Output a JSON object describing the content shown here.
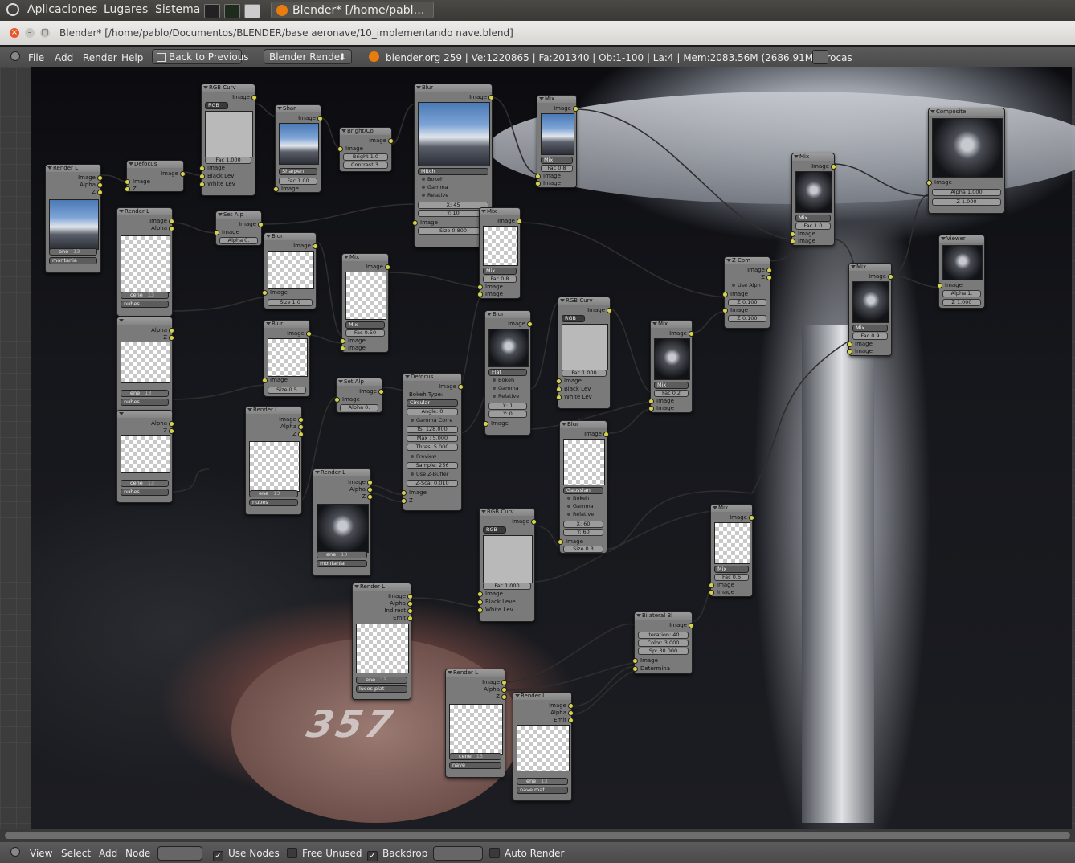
{
  "os_bar": {
    "menus": [
      "Aplicaciones",
      "Lugares",
      "Sistema"
    ],
    "task": "Blender* [/home/pabl…"
  },
  "window": {
    "title": "Blender* [/home/pablo/Documentos/BLENDER/base  aeronave/10_implementando  nave.blend]"
  },
  "header": {
    "menus": [
      "File",
      "Add",
      "Render",
      "Help"
    ],
    "back_button": "Back to Previous",
    "engine": "Blender Render",
    "stats": "blender.org 259 | Ve:1220865 | Fa:201340 | Ob:1-100 | La:4 | Mem:2083.56M (2686.91M) | rocas"
  },
  "nodes": {
    "render1": {
      "title": "Render L",
      "out": [
        "Image",
        "Alpha",
        "Z"
      ],
      "layer": "ene",
      "num": "13",
      "scene": "montania"
    },
    "defocus1": {
      "title": "Defocus",
      "out": "Image",
      "in": [
        "Image",
        "Z"
      ]
    },
    "rgbcurv1": {
      "title": "RGB Curv",
      "out": "Image",
      "tabs": "RGB",
      "fac": "Fac 1.000",
      "in": [
        "Image",
        "Black Lev",
        "White Lev"
      ]
    },
    "sharpen": {
      "title": "Shar",
      "out": "Image",
      "mode": "Sharpen",
      "fac": "Fac 1.00",
      "in": "Image"
    },
    "brightco": {
      "title": "Bright/Co",
      "out": "Image",
      "in": "Image",
      "bright": "Bright 1.0",
      "contrast": "Contrast 3."
    },
    "blur1": {
      "title": "Blur",
      "out": "Image",
      "filter": "Mitch",
      "opts": [
        "Bokeh",
        "Gamma",
        "Relative"
      ],
      "x": "X: 45",
      "y": "Y: 10",
      "in": "Image",
      "size": "Size 0.800"
    },
    "mix1": {
      "title": "Mix",
      "out": "Image",
      "mode": "Mix",
      "fac": "Fac 0.8",
      "in": [
        "Image",
        "Image"
      ]
    },
    "composite": {
      "title": "Composite",
      "in": "Image",
      "alpha": "Alpha 1.000",
      "z": "Z 1.000"
    },
    "render2": {
      "title": "Render L",
      "out": [
        "Image",
        "Alpha"
      ],
      "layer": "cene",
      "num": "13",
      "scene": "nubes"
    },
    "setalpha1": {
      "title": "Set Alp",
      "out": "Image",
      "in": "Image",
      "alpha": "Alpha 0."
    },
    "blur2": {
      "title": "Blur",
      "out": "Image",
      "in": "Image",
      "size": "Size 1.0"
    },
    "mix2": {
      "title": "Mix",
      "out": "Image",
      "mode": "Mix",
      "fac": "Fac 0.50",
      "in": [
        "Image",
        "Image"
      ]
    },
    "mix3": {
      "title": "Mix",
      "out": "Image",
      "mode": "Mix",
      "fac": "Fac 0.8",
      "in": [
        "Image",
        "Image"
      ]
    },
    "mix4": {
      "title": "Mix",
      "out": "Image",
      "mode": "Mix",
      "fac": "Fac 1.0",
      "in": [
        "Image",
        "Image"
      ]
    },
    "zcomb": {
      "title": "Z Com",
      "out": [
        "Image",
        "Z"
      ],
      "usealpha": "Use Alph",
      "in": [
        "Image",
        "Z 0.100",
        "Image",
        "Z 0.100"
      ]
    },
    "viewer": {
      "title": "Viewer",
      "in": "Image",
      "alpha": "Alpha 1.",
      "z": "Z 1.000"
    },
    "mix5": {
      "title": "Mix",
      "out": "Image",
      "mode": "Mix",
      "fac": "Fac 0.9",
      "in": [
        "Image",
        "Image"
      ]
    },
    "render3": {
      "title": "",
      "out": [
        "Alpha",
        "Z"
      ],
      "layer": "ene",
      "num": "13",
      "scene": "nubes"
    },
    "blur3": {
      "title": "Blur",
      "out": "Image",
      "in": "Image",
      "size": "Size 0.5"
    },
    "blur4": {
      "title": "Blur",
      "out": "Image",
      "filter": "Flat",
      "opts": [
        "Bokeh",
        "Gamma",
        "Relative"
      ],
      "x": "X: 1",
      "y": "Y: 0",
      "in": "Image"
    },
    "rgbcurv2": {
      "title": "RGB Curv",
      "out": "Image",
      "tabs": "RGB",
      "fac": "Fac 1.000",
      "in": [
        "Image",
        "Black Lev",
        "White Lev"
      ]
    },
    "mix6": {
      "title": "Mix",
      "out": "Image",
      "mode": "Mix",
      "fac": "Fac 0.2",
      "in": [
        "Image",
        "Image"
      ]
    },
    "render4": {
      "title": "",
      "out": [
        "Alpha",
        "Z"
      ],
      "layer": "cene",
      "num": "13",
      "scene": "nubes"
    },
    "setalpha2": {
      "title": "Set Alp",
      "out": "Image",
      "in": "Image",
      "alpha": "Alpha 0."
    },
    "defocus2": {
      "title": "Defocus",
      "out": "Image",
      "bokeh_label": "Bokeh Type:",
      "bokeh": "Circular",
      "angle": "Angle: 0",
      "gamma": "Gamma Corre",
      "fstop": "fS: 128.000",
      "max": "Max : 5.000",
      "thres": "Thres: 5.000",
      "preview": "Preview",
      "samples": "Sample: 256",
      "zbuf": "Use Z-Buffer",
      "zscale": "Z-Sca: 0.010",
      "in": [
        "Image",
        "Z"
      ]
    },
    "render5": {
      "title": "Render L",
      "out": [
        "Image",
        "Alpha",
        "Z"
      ],
      "layer": "ene",
      "num": "13",
      "scene": "nubes"
    },
    "render6": {
      "title": "Render L",
      "out": [
        "Image",
        "Alpha",
        "Z"
      ],
      "layer": "ene",
      "num": "13",
      "scene": "montania"
    },
    "blur5": {
      "title": "Blur",
      "out": "Image",
      "filter": "Gaussian",
      "opts": [
        "Bokeh",
        "Gamma",
        "Relative"
      ],
      "x": "X: 60",
      "y": "Y: 60",
      "in": "Image",
      "size": "Size 0.3"
    },
    "mix7": {
      "title": "Mix",
      "out": "Image",
      "mode": "Mix",
      "fac": "Fac 0.6",
      "in": [
        "Image",
        "Image"
      ]
    },
    "rgbcurv3": {
      "title": "RGB Curv",
      "out": "Image",
      "tabs": "RGB",
      "fac": "Fac 1.000",
      "in": [
        "Image",
        "Black Leve",
        "White Lev"
      ]
    },
    "render7": {
      "title": "Render L",
      "out": [
        "Image",
        "Alpha",
        "Indirect",
        "Emit"
      ],
      "layer": "ene",
      "num": "13",
      "scene": "luces plat"
    },
    "bilateral": {
      "title": "Bilateral Bl",
      "out": "Image",
      "iter": "Iteration: 40",
      "color": "Color: 3.000",
      "sp": "Sp: 30.000",
      "in": [
        "Image",
        "Determina"
      ]
    },
    "render8": {
      "title": "Render L",
      "out": [
        "Image",
        "Alpha",
        "Z"
      ],
      "layer": "cene",
      "num": "13",
      "scene": "nave"
    },
    "render9": {
      "title": "Render L",
      "out": [
        "Image",
        "Alpha",
        "Emit"
      ],
      "layer": "ene",
      "num": "13",
      "scene": "nave mat"
    }
  },
  "footer": {
    "menus": [
      "View",
      "Select",
      "Add",
      "Node"
    ],
    "use_nodes": "Use Nodes",
    "free_unused": "Free Unused",
    "backdrop": "Backdrop",
    "auto_render": "Auto Render"
  },
  "colors": {
    "accent": "#e87d0d",
    "socket": "#d8d44a",
    "node_bg": "#7a7a7a"
  }
}
